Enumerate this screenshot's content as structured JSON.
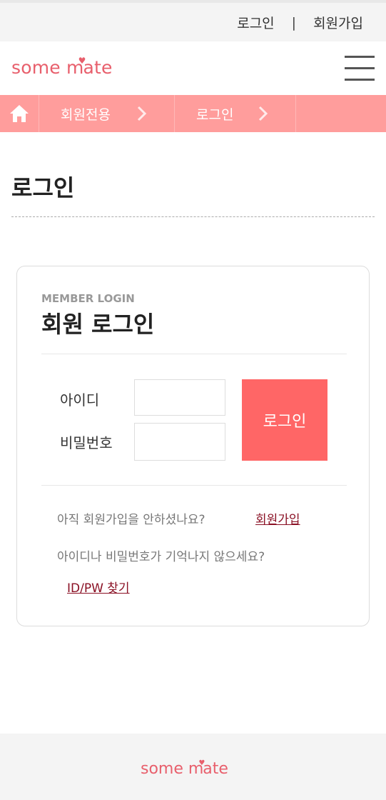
{
  "topbar": {
    "login_link": "로그인",
    "separator": "|",
    "signup_link": "회원가입"
  },
  "header": {
    "logo_part1": "some m",
    "logo_heart": "♥",
    "logo_part2": "ate",
    "menu_icon": "hamburger-icon"
  },
  "breadcrumb": {
    "home_icon": "home-icon",
    "items": [
      {
        "label": "회원전용"
      },
      {
        "label": "로그인"
      }
    ]
  },
  "page": {
    "title": "로그인"
  },
  "login_card": {
    "eyebrow": "MEMBER LOGIN",
    "heading": "회원 로그인",
    "id_label": "아이디",
    "pw_label": "비밀번호",
    "id_value": "",
    "pw_value": "",
    "login_button": "로그인",
    "signup_question": "아직 회원가입을 안하셨나요?",
    "signup_link": "회원가입",
    "find_question": "아이디나 비밀번호가 기억나지 않으세요?",
    "find_link": "ID/PW 찾기"
  },
  "footer": {
    "logo_part1": "some m",
    "logo_heart": "♥",
    "logo_part2": "ate"
  },
  "colors": {
    "brand": "#e85f6c",
    "breadcrumb_bg": "#ff9d9c",
    "login_button_bg": "#ff6666",
    "link": "#8a1024"
  }
}
